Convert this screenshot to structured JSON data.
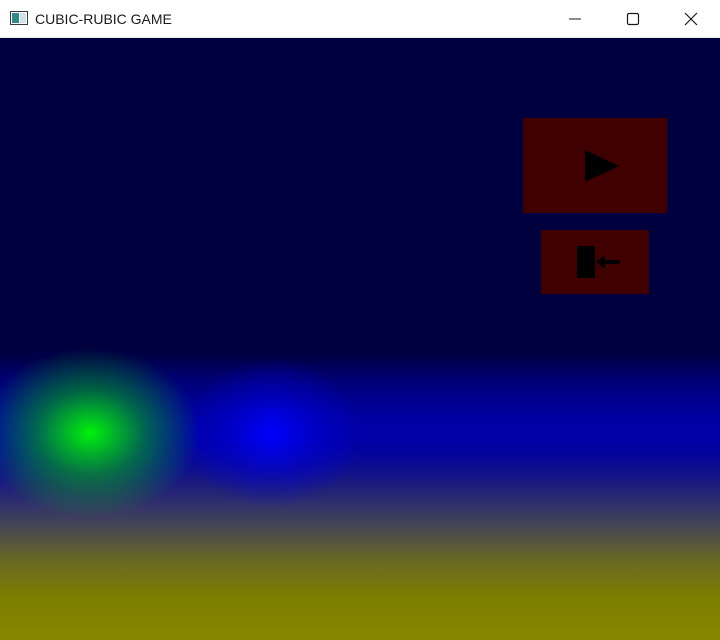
{
  "window": {
    "title": "CUBIC-RUBIC GAME"
  },
  "menu": {
    "buttons": [
      {
        "name": "play",
        "icon": "play-icon"
      },
      {
        "name": "exit",
        "icon": "exit-icon"
      }
    ]
  },
  "colors": {
    "button_bg": "#400000",
    "icon": "#000000",
    "background_dark_blue": "#00003f"
  }
}
